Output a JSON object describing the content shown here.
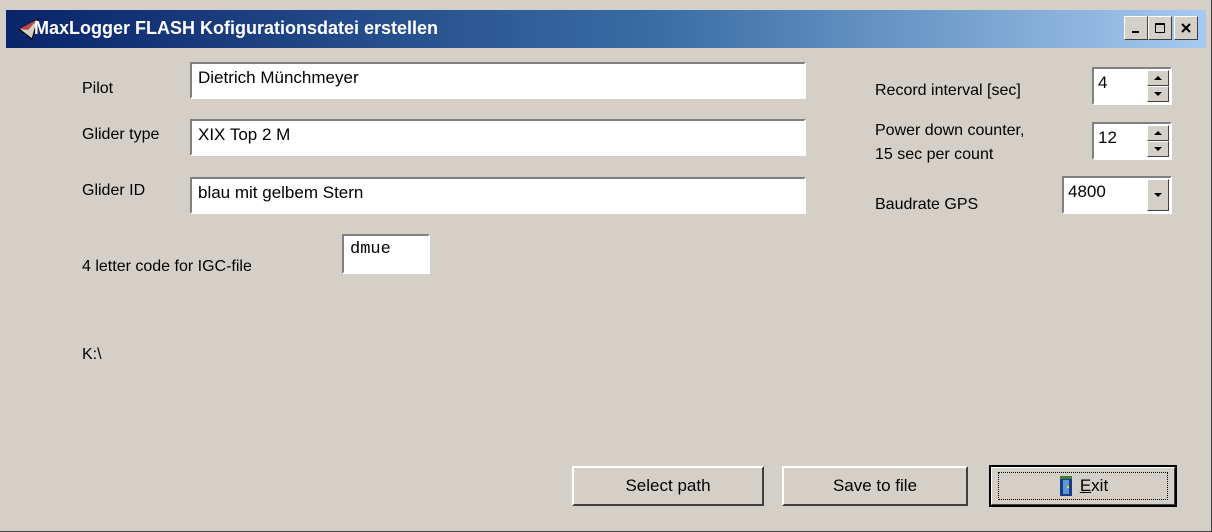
{
  "window": {
    "title": "MaxLogger FLASH Kofigurationsdatei erstellen",
    "controls": [
      "minimize-icon",
      "maximize-icon",
      "close-icon"
    ]
  },
  "form": {
    "pilot_label": "Pilot",
    "pilot_value": "Dietrich Münchmeyer",
    "glider_type_label": "Glider type",
    "glider_type_value": "XIX Top 2 M",
    "glider_id_label": "Glider ID",
    "glider_id_value": "blau mit gelbem Stern",
    "igc_code_label": "4 letter code for IGC-file",
    "igc_code_value": "dmue",
    "path_text": "K:\\"
  },
  "settings": {
    "record_interval_label": "Record interval [sec]",
    "record_interval_value": "4",
    "power_down_label_line1": "Power down counter,",
    "power_down_label_line2": "15 sec per count",
    "power_down_value": "12",
    "baudrate_label": "Baudrate GPS",
    "baudrate_value": "4800"
  },
  "buttons": {
    "select_path": "Select path",
    "save_to_file": "Save to file",
    "exit_first_letter": "E",
    "exit_rest": "xit"
  },
  "colors": {
    "face": "#d4d0c8",
    "title_start": "#0a246a",
    "title_end": "#a6caf0"
  }
}
